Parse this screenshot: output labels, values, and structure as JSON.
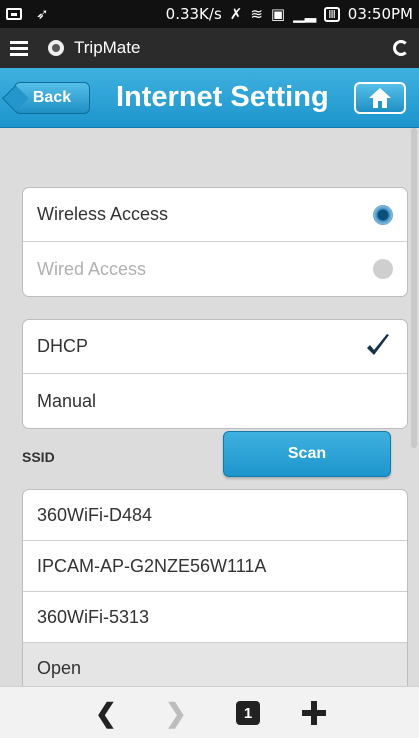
{
  "status_bar": {
    "speed": "0.33K/s",
    "time": "03:50PM",
    "battery": "Ⅲ",
    "icons": [
      "photo-icon",
      "location-off-icon",
      "no-sim-icon",
      "wifi-icon",
      "cast-icon",
      "signal-icon",
      "battery-icon"
    ]
  },
  "app_bar": {
    "title": "TripMate"
  },
  "nav": {
    "back_label": "Back",
    "title": "Internet Setting"
  },
  "access": {
    "items": [
      {
        "label": "Wireless Access",
        "selected": true,
        "enabled": true
      },
      {
        "label": "Wired Access",
        "selected": false,
        "enabled": false
      }
    ]
  },
  "ip_mode": {
    "items": [
      {
        "label": "DHCP",
        "checked": true
      },
      {
        "label": "Manual",
        "checked": false
      }
    ]
  },
  "ssid": {
    "label": "SSID",
    "scan_label": "Scan",
    "networks": [
      "360WiFi-D484",
      "IPCAM-AP-G2NZE56W111A",
      "360WiFi-5313",
      "Open"
    ]
  },
  "browser_bar": {
    "back_glyph": "❮",
    "forward_glyph": "❯",
    "tab_count": "1"
  },
  "colors": {
    "accent": "#2496cb",
    "check": "#14324a"
  }
}
